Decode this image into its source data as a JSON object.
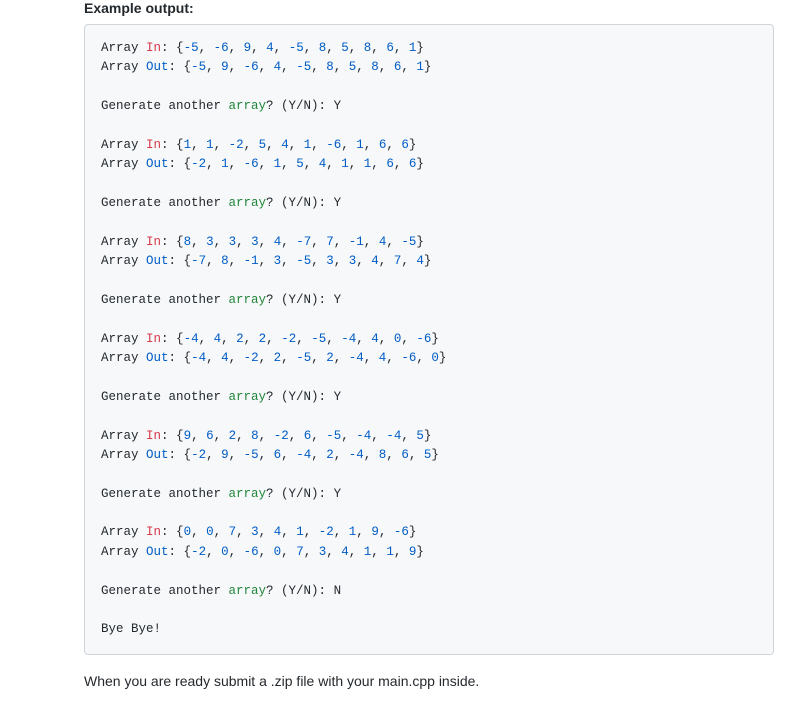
{
  "heading": "Example output:",
  "footer": "When you are ready submit a .zip file with your main.cpp inside.",
  "labels": {
    "array_word": "Array",
    "in_word": "In",
    "out_word": "Out",
    "generate_prefix": "Generate another ",
    "array_kw": "array",
    "yn_suffix": "? (Y/N): ",
    "bye": "Bye Bye!"
  },
  "runs": [
    {
      "in": [
        -5,
        -6,
        9,
        4,
        -5,
        8,
        5,
        8,
        6,
        1
      ],
      "out": [
        -5,
        9,
        -6,
        4,
        -5,
        8,
        5,
        8,
        6,
        1
      ],
      "answer": "Y"
    },
    {
      "in": [
        1,
        1,
        -2,
        5,
        4,
        1,
        -6,
        1,
        6,
        6
      ],
      "out": [
        -2,
        1,
        -6,
        1,
        5,
        4,
        1,
        1,
        6,
        6
      ],
      "answer": "Y"
    },
    {
      "in": [
        8,
        3,
        3,
        3,
        4,
        -7,
        7,
        -1,
        4,
        -5
      ],
      "out": [
        -7,
        8,
        -1,
        3,
        -5,
        3,
        3,
        4,
        7,
        4
      ],
      "answer": "Y"
    },
    {
      "in": [
        -4,
        4,
        2,
        2,
        -2,
        -5,
        -4,
        4,
        0,
        -6
      ],
      "out": [
        -4,
        4,
        -2,
        2,
        -5,
        2,
        -4,
        4,
        -6,
        0
      ],
      "answer": "Y"
    },
    {
      "in": [
        9,
        6,
        2,
        8,
        -2,
        6,
        -5,
        -4,
        -4,
        5
      ],
      "out": [
        -2,
        9,
        -5,
        6,
        -4,
        2,
        -4,
        8,
        6,
        5
      ],
      "answer": "Y"
    },
    {
      "in": [
        0,
        0,
        7,
        3,
        4,
        1,
        -2,
        1,
        9,
        -6
      ],
      "out": [
        -2,
        0,
        -6,
        0,
        7,
        3,
        4,
        1,
        1,
        9
      ],
      "answer": "N"
    }
  ]
}
